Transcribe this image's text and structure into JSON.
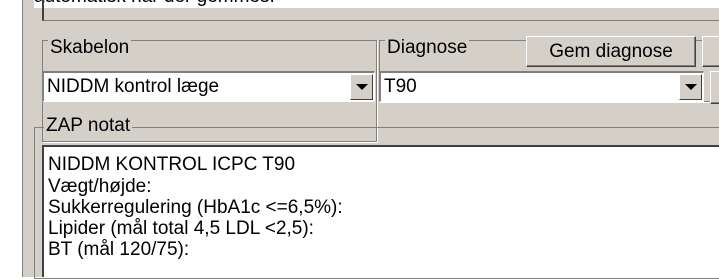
{
  "top_text": "automatisk når der gemmes.",
  "skabelon": {
    "legend": "Skabelon",
    "selected": "NIDDM kontrol læge"
  },
  "diagnose": {
    "legend": "Diagnose",
    "save_button": "Gem diagnose",
    "selected": "T90"
  },
  "zap": {
    "legend": "ZAP notat",
    "lines": [
      "NIDDM KONTROL    ICPC T90",
      "Vægt/højde:",
      "Sukkerregulering (HbA1c <=6,5%):",
      "Lipider (mål total 4,5 LDL <2,5):",
      "BT  (mål 120/75):"
    ]
  }
}
